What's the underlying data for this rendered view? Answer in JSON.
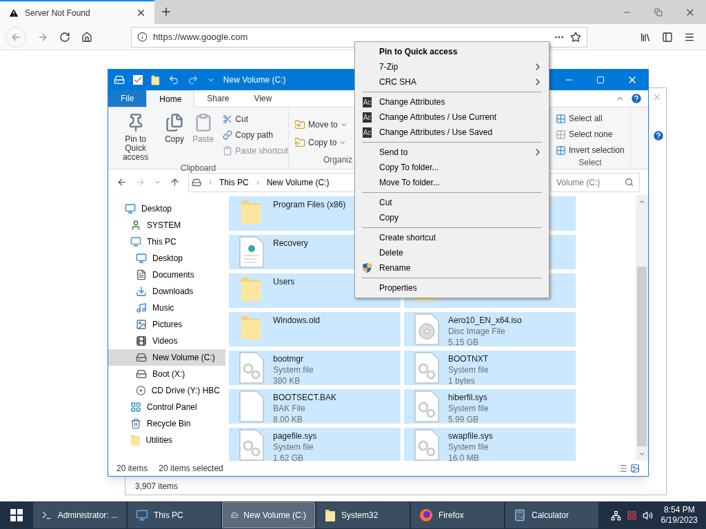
{
  "browser": {
    "tab": {
      "title": "Server Not Found"
    },
    "url": "https://www.google.com"
  },
  "back_window": {
    "status": "3,907 items"
  },
  "explorer": {
    "title": "New Volume (C:)",
    "tabs": [
      {
        "label": "File",
        "kind": "file",
        "selected": false
      },
      {
        "label": "Home",
        "kind": "tab",
        "selected": true
      },
      {
        "label": "Share",
        "kind": "tab",
        "selected": false
      },
      {
        "label": "View",
        "kind": "tab",
        "selected": false
      }
    ],
    "clipboard": {
      "label": "Clipboard",
      "large": [
        {
          "label": "Pin to Quick access",
          "kind": "pin",
          "disabled": false
        },
        {
          "label": "Copy",
          "kind": "copy",
          "disabled": false
        },
        {
          "label": "Paste",
          "kind": "paste",
          "disabled": true
        }
      ],
      "small": [
        {
          "label": "Cut",
          "kind": "cut",
          "disabled": false
        },
        {
          "label": "Copy path",
          "kind": "path",
          "disabled": false
        },
        {
          "label": "Paste shortcut",
          "kind": "shortcut",
          "disabled": true
        }
      ]
    },
    "organize": {
      "label": "Organiz",
      "items": [
        {
          "label": "Move to"
        },
        {
          "label": "Copy to"
        }
      ]
    },
    "select": {
      "label": "Select",
      "items": [
        {
          "label": "Select all",
          "kind": "all"
        },
        {
          "label": "Select none",
          "kind": "none"
        },
        {
          "label": "Invert selection",
          "kind": "invert"
        }
      ]
    },
    "breadcrumbs": [
      "This PC",
      "New Volume (C:)"
    ],
    "search": {
      "placeholder": "Volume (C:)"
    },
    "nav": [
      {
        "label": "Desktop",
        "kind": "desktop",
        "selected": false,
        "children": [
          {
            "label": "SYSTEM",
            "kind": "user",
            "selected": false
          },
          {
            "label": "This PC",
            "kind": "pc",
            "selected": false,
            "children": [
              {
                "label": "Desktop",
                "kind": "desktop",
                "selected": false
              },
              {
                "label": "Documents",
                "kind": "documents",
                "selected": false
              },
              {
                "label": "Downloads",
                "kind": "downloads",
                "selected": false
              },
              {
                "label": "Music",
                "kind": "music",
                "selected": false
              },
              {
                "label": "Pictures",
                "kind": "pictures",
                "selected": false
              },
              {
                "label": "Videos",
                "kind": "videos",
                "selected": false
              },
              {
                "label": "New Volume (C:)",
                "kind": "drive",
                "selected": true
              },
              {
                "label": "Boot (X:)",
                "kind": "drive",
                "selected": false
              },
              {
                "label": "CD Drive (Y:) HBC",
                "kind": "cd",
                "selected": false
              }
            ]
          },
          {
            "label": "Control Panel",
            "kind": "control",
            "selected": false
          },
          {
            "label": "Recycle Bin",
            "kind": "recycle",
            "selected": false
          },
          {
            "label": "Utilities",
            "kind": "folder",
            "selected": false
          }
        ]
      }
    ],
    "files": [
      {
        "name": "Program Files (x86)",
        "kind": "folder",
        "selected": true
      },
      {
        "selected": true
      },
      {
        "name": "Recovery",
        "kind": "recovery",
        "selected": true
      },
      {
        "selected": true
      },
      {
        "name": "Users",
        "kind": "folder",
        "selected": true
      },
      {
        "kind": "folder",
        "selected": true
      },
      {
        "name": "Windows.old",
        "kind": "folder",
        "selected": true
      },
      {
        "name": "Aero10_EN_x64.iso",
        "type": "Disc Image File",
        "size": "5.15 GB",
        "kind": "disc",
        "selected": true
      },
      {
        "name": "bootmgr",
        "type": "System file",
        "size": "380 KB",
        "kind": "system",
        "selected": true
      },
      {
        "name": "BOOTNXT",
        "type": "System file",
        "size": "1 bytes",
        "kind": "system",
        "selected": true
      },
      {
        "name": "BOOTSECT.BAK",
        "type": "BAK File",
        "size": "8.00 KB",
        "kind": "blank",
        "selected": true
      },
      {
        "name": "hiberfil.sys",
        "type": "System file",
        "size": "5.99 GB",
        "kind": "system",
        "selected": true
      },
      {
        "name": "pagefile.sys",
        "type": "System file",
        "size": "1.62 GB",
        "kind": "system",
        "selected": true
      },
      {
        "name": "swapfile.sys",
        "type": "System file",
        "size": "16.0 MB",
        "kind": "system",
        "selected": true
      }
    ],
    "status": {
      "count": "20 items",
      "selected": "20 items selected"
    }
  },
  "context_menu": [
    {
      "kind": "item",
      "label": "Pin to Quick access",
      "bold": true
    },
    {
      "kind": "submenu",
      "label": "7-Zip"
    },
    {
      "kind": "submenu",
      "label": "CRC SHA"
    },
    {
      "kind": "separator"
    },
    {
      "kind": "item",
      "label": "Change Attributes",
      "badge": "Ac"
    },
    {
      "kind": "item",
      "label": "Change Attributes / Use Current",
      "badge": "Ac"
    },
    {
      "kind": "item",
      "label": "Change Attributes / Use Saved",
      "badge": "Ac"
    },
    {
      "kind": "separator"
    },
    {
      "kind": "submenu",
      "label": "Send to"
    },
    {
      "kind": "item",
      "label": "Copy To folder..."
    },
    {
      "kind": "item",
      "label": "Move To folder..."
    },
    {
      "kind": "separator"
    },
    {
      "kind": "item",
      "label": "Cut"
    },
    {
      "kind": "item",
      "label": "Copy"
    },
    {
      "kind": "separator"
    },
    {
      "kind": "item",
      "label": "Create shortcut"
    },
    {
      "kind": "item",
      "label": "Delete"
    },
    {
      "kind": "item",
      "label": "Rename",
      "shield": true
    },
    {
      "kind": "separator"
    },
    {
      "kind": "item",
      "label": "Properties"
    }
  ],
  "taskbar": {
    "items": [
      {
        "label": "Administrator: ...",
        "kind": "terminal",
        "selected": false
      },
      {
        "label": "This PC",
        "kind": "pc",
        "selected": false
      },
      {
        "label": "New Volume (C:)",
        "kind": "drive",
        "selected": true
      },
      {
        "label": "System32",
        "kind": "folder",
        "selected": false
      },
      {
        "label": "Firefox",
        "kind": "firefox",
        "selected": false
      },
      {
        "label": "Calculator",
        "kind": "calculator",
        "selected": false
      }
    ],
    "time": "8:54 PM",
    "date": "6/19/2023"
  }
}
